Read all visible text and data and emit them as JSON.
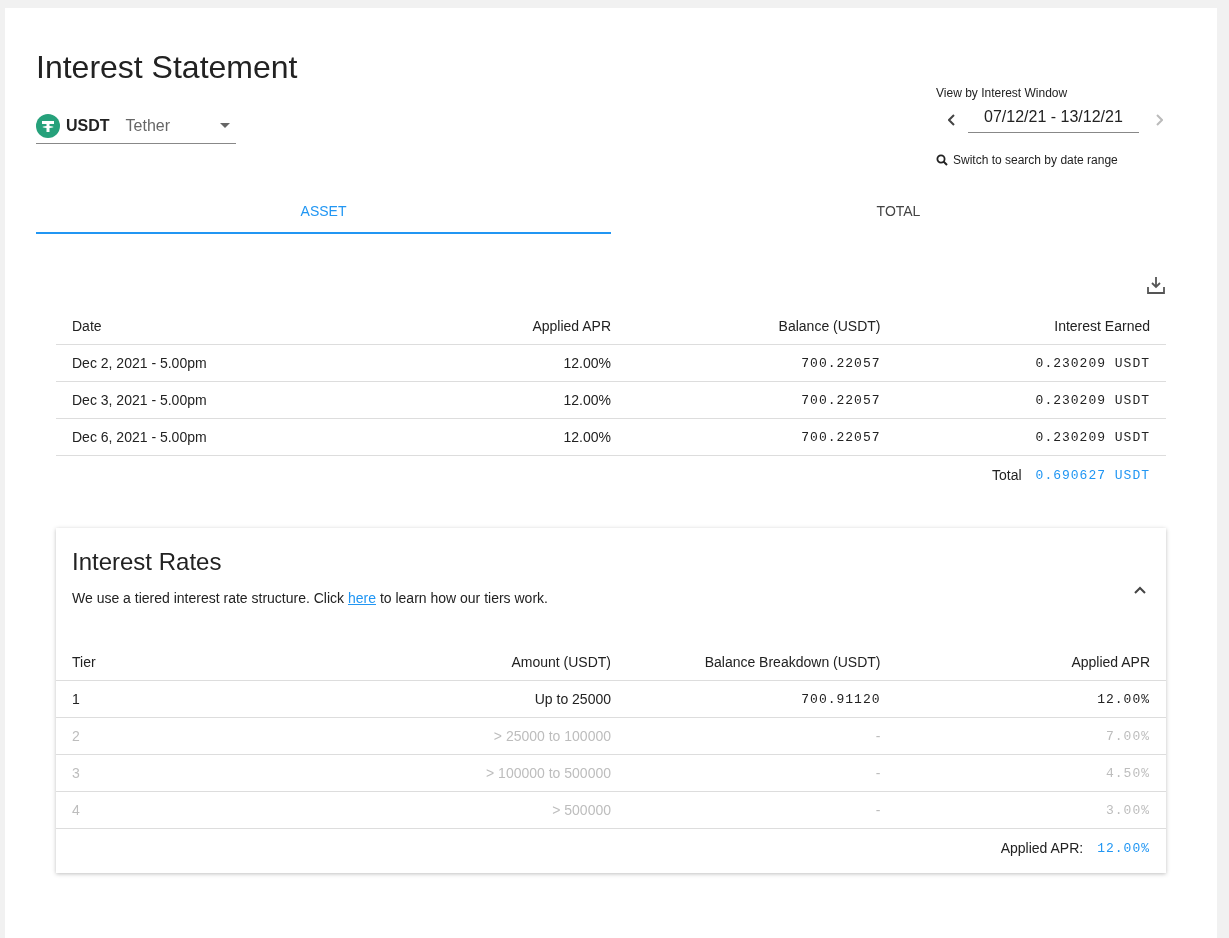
{
  "title": "Interest Statement",
  "asset_selector": {
    "symbol": "USDT",
    "name": "Tether"
  },
  "interest_window": {
    "label": "View by Interest Window",
    "value": "07/12/21 - 13/12/21",
    "switch_link": "Switch to search by date range"
  },
  "tabs": [
    {
      "label": "ASSET",
      "selected": true
    },
    {
      "label": "TOTAL",
      "selected": false
    }
  ],
  "statement_table": {
    "columns": [
      "Date",
      "Applied APR",
      "Balance (USDT)",
      "Interest Earned"
    ],
    "rows": [
      [
        "Dec 2, 2021 - 5.00pm",
        "12.00%",
        "700.22057",
        "0.230209 USDT"
      ],
      [
        "Dec 3, 2021 - 5.00pm",
        "12.00%",
        "700.22057",
        "0.230209 USDT"
      ],
      [
        "Dec 6, 2021 - 5.00pm",
        "12.00%",
        "700.22057",
        "0.230209 USDT"
      ]
    ],
    "total_label": "Total",
    "total_value": "0.690627 USDT"
  },
  "interest_rates": {
    "title": "Interest Rates",
    "expanded": true,
    "description_before": "We use a tiered interest rate structure. Click ",
    "link": "here",
    "description_after": " to learn how our tiers work.",
    "columns": [
      "Tier",
      "Amount (USDT)",
      "Balance Breakdown (USDT)",
      "Applied APR"
    ],
    "rows": [
      {
        "cells": [
          "1",
          "Up to 25000",
          "700.91120",
          "12.00%"
        ],
        "active": true
      },
      {
        "cells": [
          "2",
          "> 25000 to 100000",
          "-",
          "7.00%"
        ],
        "active": false
      },
      {
        "cells": [
          "3",
          "> 100000 to 500000",
          "-",
          "4.50%"
        ],
        "active": false
      },
      {
        "cells": [
          "4",
          "> 500000",
          "-",
          "3.00%"
        ],
        "active": false
      }
    ],
    "applied_label": "Applied APR:",
    "applied_value": "12.00%"
  }
}
